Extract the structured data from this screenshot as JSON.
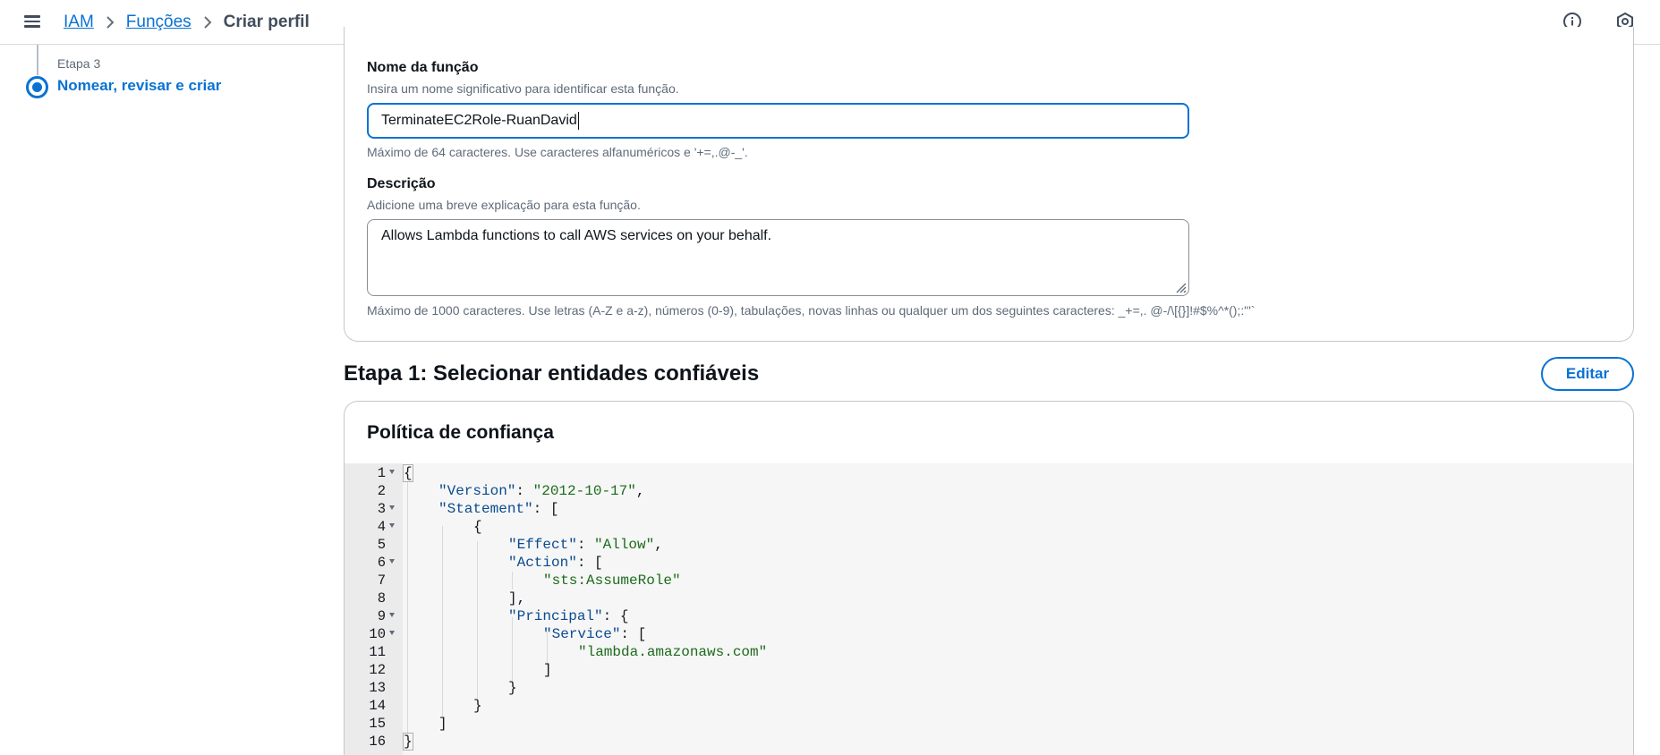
{
  "topbar": {
    "breadcrumb": {
      "items": [
        "IAM",
        "Funções"
      ],
      "current": "Criar perfil"
    },
    "icons": [
      "menu-icon",
      "info-icon",
      "settings-hexagon-icon"
    ]
  },
  "steps": {
    "step_label": "Etapa 3",
    "step_title": "Nomear, revisar e criar"
  },
  "role_name": {
    "label": "Nome da função",
    "description": "Insira um nome significativo para identificar esta função.",
    "value": "TerminateEC2Role-RuanDavid",
    "constraint": "Máximo de 64 caracteres. Use caracteres alfanuméricos e '+=,.@-_'."
  },
  "role_description": {
    "label": "Descrição",
    "description": "Adicione uma breve explicação para esta função.",
    "value": "Allows Lambda functions to call AWS services on your behalf.",
    "constraint": "Máximo de 1000 caracteres. Use letras (A-Z e a-z), números (0-9), tabulações, novas linhas ou qualquer um dos seguintes caracteres: _+=,. @-/\\[{}]!#$%^*();:\"'`"
  },
  "section": {
    "title": "Etapa 1: Selecionar entidades confiáveis",
    "edit_label": "Editar"
  },
  "trust_policy": {
    "title": "Política de confiança",
    "lines": [
      {
        "no": "1",
        "fold": true
      },
      {
        "no": "2",
        "fold": false
      },
      {
        "no": "3",
        "fold": true
      },
      {
        "no": "4",
        "fold": true
      },
      {
        "no": "5",
        "fold": false
      },
      {
        "no": "6",
        "fold": true
      },
      {
        "no": "7",
        "fold": false
      },
      {
        "no": "8",
        "fold": false
      },
      {
        "no": "9",
        "fold": true
      },
      {
        "no": "10",
        "fold": true
      },
      {
        "no": "11",
        "fold": false
      },
      {
        "no": "12",
        "fold": false
      },
      {
        "no": "13",
        "fold": false
      },
      {
        "no": "14",
        "fold": false
      },
      {
        "no": "15",
        "fold": false
      },
      {
        "no": "16",
        "fold": false
      }
    ],
    "code": {
      "l1_open": "{",
      "l2_key": "\"Version\"",
      "l2_sep": ": ",
      "l2_val": "\"2012-10-17\"",
      "l2_end": ",",
      "l3_key": "\"Statement\"",
      "l3_rest": ": [",
      "l4_open": "{",
      "l5_key": "\"Effect\"",
      "l5_sep": ": ",
      "l5_val": "\"Allow\"",
      "l5_end": ",",
      "l6_key": "\"Action\"",
      "l6_rest": ": [",
      "l7_val": "\"sts:AssumeRole\"",
      "l8_close": "],",
      "l9_key": "\"Principal\"",
      "l9_rest": ": {",
      "l10_key": "\"Service\"",
      "l10_rest": ": [",
      "l11_val": "\"lambda.amazonaws.com\"",
      "l12_close": "]",
      "l13_close": "}",
      "l14_close": "}",
      "l15_close": "]",
      "l16_close": "}"
    }
  }
}
